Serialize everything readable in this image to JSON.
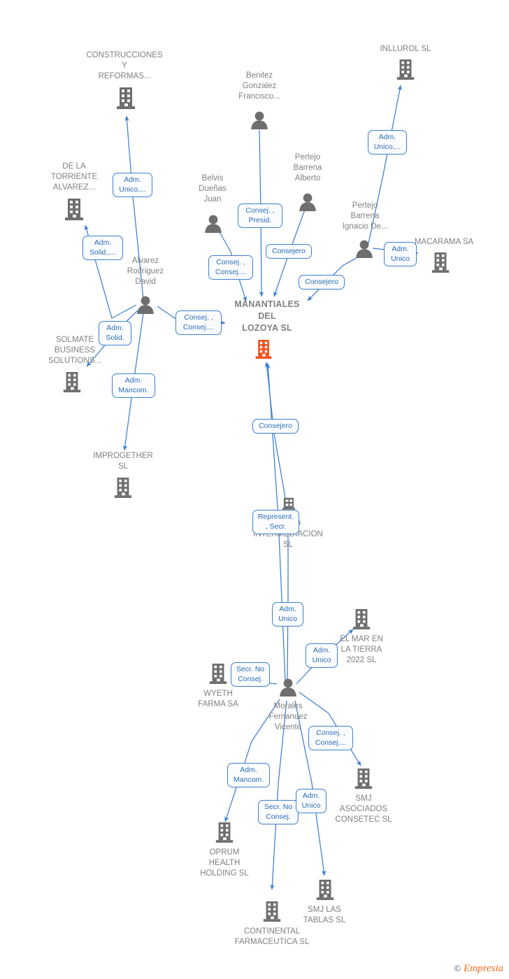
{
  "diagram": {
    "title": "MANANTIALES DEL LOZOYA SL",
    "type": "corporate-relationship-graph",
    "watermark": {
      "copyright": "©",
      "brand": "Empresia"
    },
    "colors": {
      "node_label": "#808080",
      "edge": "#3d7fd1",
      "relation_text": "#2b6cb8",
      "focus_company": "#f4521e",
      "company_icon": "#6e6e6e",
      "person_icon": "#6e6e6e"
    }
  },
  "nodes": [
    {
      "id": "construcciones",
      "kind": "company",
      "label": "CONSTRUCCIONES\nY\nREFORMAS..."
    },
    {
      "id": "delatorriente",
      "kind": "company",
      "label": "DE LA\nTORRIENTE\nALVAREZ..."
    },
    {
      "id": "alvarez",
      "kind": "person",
      "label": "Alvarez\nRodriguez\nDavid"
    },
    {
      "id": "solmate",
      "kind": "company",
      "label": "SOLMATE\nBUSINESS\nSOLUTIONS..."
    },
    {
      "id": "improgether",
      "kind": "company",
      "label": "IMPROGETHER\nSL"
    },
    {
      "id": "belvis",
      "kind": "person",
      "label": "Belvis\nDueñas\nJuan"
    },
    {
      "id": "benitez",
      "kind": "person",
      "label": "Benitez\nGonzalez\nFrancisco..."
    },
    {
      "id": "pertejoalberto",
      "kind": "person",
      "label": "Pertejo\nBarrena\nAlberto"
    },
    {
      "id": "pertejoignacio",
      "kind": "person",
      "label": "Pertejo\nBarrena\nIgnacio De..."
    },
    {
      "id": "inllurol",
      "kind": "company",
      "label": "INLLUROL  SL"
    },
    {
      "id": "macarama",
      "kind": "company",
      "label": "MACARAMA SA"
    },
    {
      "id": "manantiales",
      "kind": "company",
      "label": "MANANTIALES\nDEL\nLOZOYA  SL",
      "focus": true
    },
    {
      "id": "como",
      "kind": "company",
      "label": "COMO\nINTERMEDIACION\nSL"
    },
    {
      "id": "elmar",
      "kind": "company",
      "label": "EL MAR EN\nLA TIERRA\n2022  SL"
    },
    {
      "id": "wyeth",
      "kind": "company",
      "label": "WYETH\nFARMA SA"
    },
    {
      "id": "morales",
      "kind": "person",
      "label": "Morales\nFernandez\nVicente"
    },
    {
      "id": "smjasociados",
      "kind": "company",
      "label": "SMJ\nASOCIADOS\nCONSETEC  SL"
    },
    {
      "id": "oprum",
      "kind": "company",
      "label": "OPRUM\nHEALTH\nHOLDING  SL"
    },
    {
      "id": "smjlastablas",
      "kind": "company",
      "label": "SMJ LAS\nTABLAS  SL"
    },
    {
      "id": "continental",
      "kind": "company",
      "label": "CONTINENTAL\nFARMACEUTICA SL"
    }
  ],
  "relations": [
    {
      "id": "r1",
      "text": "Adm.\nUnico,...",
      "from": "alvarez",
      "to": "construcciones"
    },
    {
      "id": "r2",
      "text": "Adm.\nSolid.,...",
      "from": "alvarez",
      "to": "delatorriente"
    },
    {
      "id": "r3",
      "text": "Adm.\nSolid.",
      "from": "alvarez",
      "to": "solmate"
    },
    {
      "id": "r4",
      "text": "Adm.\nMancom.",
      "from": "alvarez",
      "to": "improgether"
    },
    {
      "id": "r5",
      "text": "Consej. ,\nConsej....",
      "from": "alvarez",
      "to": "manantiales"
    },
    {
      "id": "r6",
      "text": "Consej. ,\nConsej....",
      "from": "belvis",
      "to": "manantiales"
    },
    {
      "id": "r7",
      "text": "Consej. ,\nPresid.",
      "from": "benitez",
      "to": "manantiales"
    },
    {
      "id": "r8",
      "text": "Consejero",
      "from": "pertejoalberto",
      "to": "manantiales"
    },
    {
      "id": "r9",
      "text": "Consejero",
      "from": "pertejoignacio",
      "to": "manantiales"
    },
    {
      "id": "r10",
      "text": "Adm.\nUnico,...",
      "from": "pertejoignacio",
      "to": "inllurol"
    },
    {
      "id": "r11",
      "text": "Adm.\nUnico",
      "from": "pertejoignacio",
      "to": "macarama"
    },
    {
      "id": "r12",
      "text": "Consejero",
      "from": "como",
      "to": "manantiales"
    },
    {
      "id": "r13",
      "text": "Represent.\n, Secr.",
      "from": "morales",
      "to": "manantiales"
    },
    {
      "id": "r14",
      "text": "Adm.\nUnico",
      "from": "morales",
      "to": "como"
    },
    {
      "id": "r15",
      "text": "Adm.\nUnico",
      "from": "morales",
      "to": "elmar"
    },
    {
      "id": "r16",
      "text": "Secr.  No\nConsej.",
      "from": "morales",
      "to": "wyeth"
    },
    {
      "id": "r17",
      "text": "Consej. ,\nConsej....",
      "from": "morales",
      "to": "smjasociados"
    },
    {
      "id": "r18",
      "text": "Adm.\nMancom.",
      "from": "morales",
      "to": "oprum"
    },
    {
      "id": "r19",
      "text": "Secr.  No\nConsej.",
      "from": "morales",
      "to": "continental"
    },
    {
      "id": "r20",
      "text": "Adm.\nUnico",
      "from": "morales",
      "to": "smjlastablas"
    }
  ]
}
